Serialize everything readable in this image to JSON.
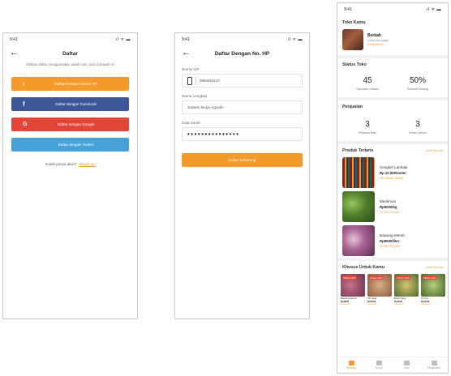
{
  "screen1": {
    "time": "9:41",
    "signal": ".ıl ᯤ ▬",
    "back_icon": "arrow-left-icon",
    "title": "Daftar",
    "subtitle": "Silakan daftar menggunakan salah satu cara di bawah ini",
    "buttons": [
      {
        "label": "Daftar Dengan Nomor HP",
        "icon": "phone-icon",
        "glyph": "▯",
        "color": "#f39a2b"
      },
      {
        "label": "Daftar dengan Facebook",
        "icon": "facebook-icon",
        "glyph": "f",
        "color": "#3b5797"
      },
      {
        "label": "Daftar dengan Google",
        "icon": "google-icon",
        "glyph": "G",
        "color": "#e24639"
      },
      {
        "label": "Daftar dengan Twitter",
        "icon": "twitter-icon",
        "glyph": "🐦",
        "color": "#45a1d8"
      }
    ],
    "login_prompt": "Sudah punya akun?",
    "login_link": "Masuk aja"
  },
  "screen2": {
    "time": "9:41",
    "signal": ".ıl ᯤ ▬",
    "title": "Daftar Dengan No. HP",
    "phone_label": "Nomor HP",
    "phone_value": "0894563137",
    "name_label": "Nama Lengkap",
    "name_value": "Sukarni Mulyo Agustin",
    "password_label": "Kata Sandi",
    "password_value": "•••••••••••••••",
    "submit_label": "Daftar Sekarang"
  },
  "screen3": {
    "time": "9:41",
    "signal": ".ıl ᯤ ▬",
    "store_section": "Toko Kamu",
    "store_name": "Berkah",
    "store_sub": "Lihat toko saya",
    "store_link": "Pengaturan",
    "status_section": "Status Toko",
    "stats": [
      {
        "value": "45",
        "label": "Transaksi Sukses"
      },
      {
        "value": "50%",
        "label": "Pembeli Senang"
      }
    ],
    "sales_section": "Penjualan",
    "sales": [
      {
        "value": "3",
        "label": "Pesanan Baru"
      },
      {
        "value": "3",
        "label": "Pesan Masuk"
      }
    ],
    "popular_section": "Produk Terlaris",
    "popular_more": "Lihat Semua",
    "products": [
      {
        "name": "Songket Lambak",
        "price": "Rp 10.000/meter",
        "sold": "250 Meter Terjual"
      },
      {
        "name": "Mentimun",
        "price": "Rp5000/kg",
        "sold": "29 Kilo Terjual"
      },
      {
        "name": "Bawang Merah",
        "price": "Rp8000/liter",
        "sold": "50 liter Terjual"
      }
    ],
    "special_section": "Khusus Untuk Kamu",
    "special_more": "Lihat Semua",
    "cards": [
      {
        "discount": "Diskon 20%",
        "name": "Bawang Merah",
        "price": "Rp8000",
        "sold": "Terjual 20"
      },
      {
        "discount": "Diskon 20%",
        "name": "Ubi Jalar",
        "price": "Rp5000",
        "sold": "Terjual 15"
      },
      {
        "discount": "Diskon 20%",
        "name": "Buah Naga",
        "price": "Rp9000",
        "sold": "Terjual 10"
      },
      {
        "discount": "Diskon 20%",
        "name": "Terong",
        "price": "Rp4000",
        "sold": "Terjual 12"
      }
    ],
    "tabs": [
      {
        "label": "Beranda",
        "icon": "home-icon"
      },
      {
        "label": "Produk",
        "icon": "product-icon"
      },
      {
        "label": "Toko",
        "icon": "store-icon"
      },
      {
        "label": "Pengaturan",
        "icon": "settings-icon"
      }
    ]
  }
}
